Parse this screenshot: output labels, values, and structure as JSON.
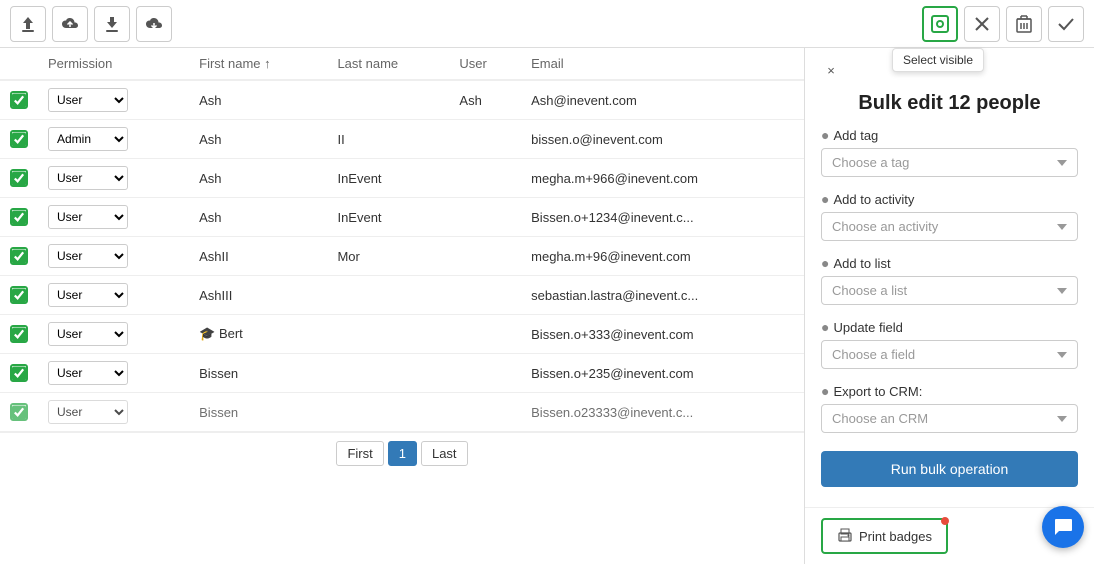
{
  "toolbar": {
    "buttons": [
      {
        "name": "upload-icon",
        "icon": "⬆",
        "label": "Upload"
      },
      {
        "name": "cloud-upload-icon",
        "icon": "☁",
        "label": "Cloud Upload"
      },
      {
        "name": "download-icon",
        "icon": "⬇",
        "label": "Download"
      },
      {
        "name": "cloud-download-icon",
        "icon": "⤓",
        "label": "Cloud Download"
      }
    ],
    "right_buttons": [
      {
        "name": "select-visible-button",
        "icon": "◎",
        "label": "Select visible",
        "active": true
      },
      {
        "name": "close-icon-btn",
        "icon": "✕",
        "label": "Close"
      },
      {
        "name": "trash-icon-btn",
        "icon": "🗑",
        "label": "Delete"
      },
      {
        "name": "check-icon-btn",
        "icon": "✓",
        "label": "Confirm"
      }
    ],
    "tooltip": "Select visible"
  },
  "table": {
    "columns": [
      "Permission",
      "First name ↑",
      "Last name",
      "User",
      "Email"
    ],
    "rows": [
      {
        "checked": true,
        "permission": "User",
        "first_name": "Ash",
        "last_name": "",
        "user": "Ash",
        "email": "Ash@inevent.com"
      },
      {
        "checked": true,
        "permission": "Admin",
        "first_name": "Ash",
        "last_name": "II",
        "user": "",
        "email": "bissen.o@inevent.com"
      },
      {
        "checked": true,
        "permission": "User",
        "first_name": "Ash",
        "last_name": "InEvent",
        "user": "",
        "email": "megha.m+966@inevent.com"
      },
      {
        "checked": true,
        "permission": "User",
        "first_name": "Ash",
        "last_name": "InEvent",
        "user": "",
        "email": "Bissen.o+1234@inevent.c..."
      },
      {
        "checked": true,
        "permission": "User",
        "first_name": "AshII",
        "last_name": "Mor",
        "user": "",
        "email": "megha.m+96@inevent.com"
      },
      {
        "checked": true,
        "permission": "User",
        "first_name": "AshIII",
        "last_name": "",
        "user": "",
        "email": "sebastian.lastra@inevent.c..."
      },
      {
        "checked": true,
        "permission": "User",
        "first_name": "Bert",
        "last_name": "",
        "user": "",
        "email": "Bissen.o+333@inevent.com",
        "grad": true
      },
      {
        "checked": true,
        "permission": "User",
        "first_name": "Bissen",
        "last_name": "",
        "user": "",
        "email": "Bissen.o+235@inevent.com"
      },
      {
        "checked": true,
        "permission": "User",
        "first_name": "Bissen",
        "last_name": "",
        "user": "",
        "email": "Bissen.o23333@inevent.c...",
        "partial": true
      }
    ]
  },
  "pagination": {
    "first_label": "First",
    "last_label": "Last",
    "current_page": 1,
    "pages": [
      1
    ]
  },
  "right_panel": {
    "title": "Bulk edit 12 people",
    "close_label": "×",
    "sections": [
      {
        "label": "Add tag",
        "placeholder": "Choose a tag",
        "name": "add-tag-select"
      },
      {
        "label": "Add to activity",
        "placeholder": "Choose an activity",
        "name": "add-activity-select"
      },
      {
        "label": "Add to list",
        "placeholder": "Choose a list",
        "name": "add-list-select"
      },
      {
        "label": "Update field",
        "placeholder": "Choose a field",
        "name": "update-field-select"
      },
      {
        "label": "Export to CRM:",
        "placeholder": "Choose an CRM",
        "name": "export-crm-select"
      }
    ],
    "run_button_label": "Run bulk operation",
    "print_badges_label": "Print badges"
  }
}
